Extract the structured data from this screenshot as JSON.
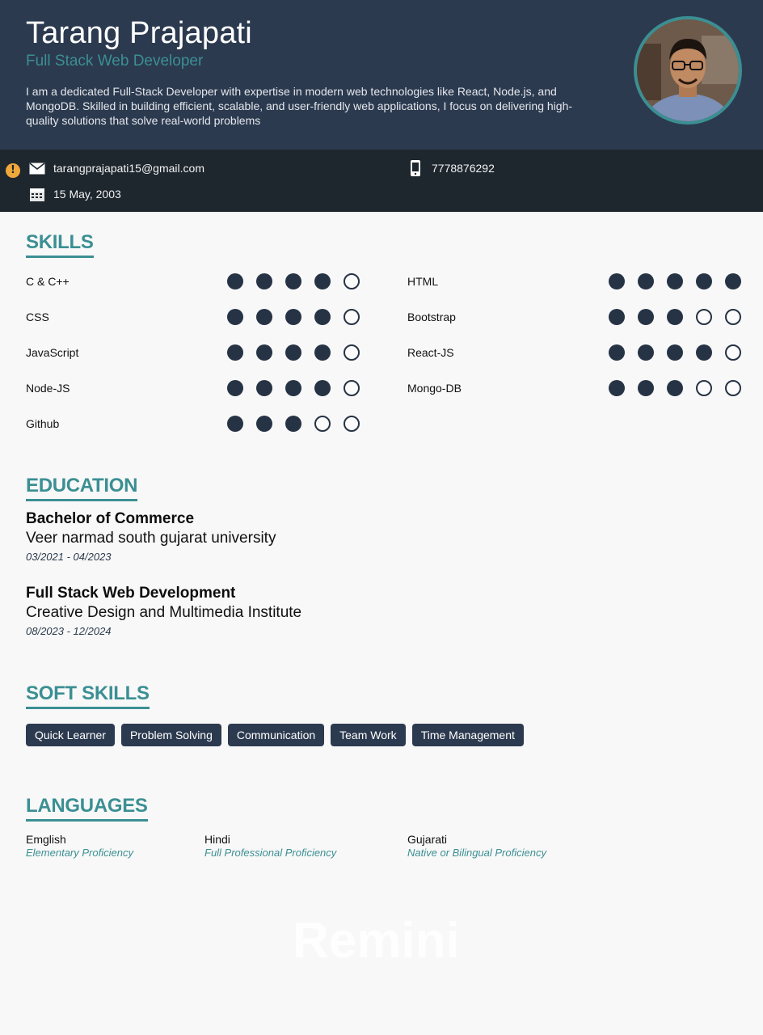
{
  "profile": {
    "name": "Tarang Prajapati",
    "role": "Full Stack Web Developer",
    "summary": "I am a dedicated Full-Stack Developer with expertise in modern web technologies like React, Node.js, and MongoDB. Skilled in building efficient, scalable, and user-friendly web applications, I focus on delivering high-quality solutions that solve real-world problems"
  },
  "contact": {
    "email": "tarangprajapati15@gmail.com",
    "phone": "7778876292",
    "dob": "15 May, 2003"
  },
  "sections": {
    "skills": "SKILLS",
    "education": "EDUCATION",
    "soft_skills": "SOFT SKILLS",
    "languages": "LANGUAGES"
  },
  "skills": [
    {
      "name": "C & C++",
      "level": 4,
      "max": 5
    },
    {
      "name": "HTML",
      "level": 5,
      "max": 5
    },
    {
      "name": "CSS",
      "level": 4,
      "max": 5
    },
    {
      "name": "Bootstrap",
      "level": 3,
      "max": 5
    },
    {
      "name": "JavaScript",
      "level": 4,
      "max": 5
    },
    {
      "name": "React-JS",
      "level": 4,
      "max": 5
    },
    {
      "name": "Node-JS",
      "level": 4,
      "max": 5
    },
    {
      "name": "Mongo-DB",
      "level": 3,
      "max": 5
    },
    {
      "name": "Github",
      "level": 3,
      "max": 5
    }
  ],
  "education": [
    {
      "degree": "Bachelor of Commerce",
      "institution": "Veer narmad south gujarat university",
      "dates": "03/2021 - 04/2023"
    },
    {
      "degree": "Full Stack Web Development",
      "institution": "Creative Design and Multimedia Institute",
      "dates": "08/2023 - 12/2024"
    }
  ],
  "soft_skills": [
    "Quick Learner",
    "Problem Solving",
    "Communication",
    "Team Work",
    "Time Management"
  ],
  "languages": [
    {
      "name": "Emglish",
      "proficiency": "Elementary Proficiency"
    },
    {
      "name": "Hindi",
      "proficiency": "Full Professional Proficiency"
    },
    {
      "name": "Gujarati",
      "proficiency": "Native or Bilingual Proficiency"
    }
  ],
  "watermark": "Remini",
  "colors": {
    "header_bg": "#2c3a4f",
    "contact_bg": "#1e262e",
    "accent": "#3b8f93",
    "dot": "#263345"
  }
}
